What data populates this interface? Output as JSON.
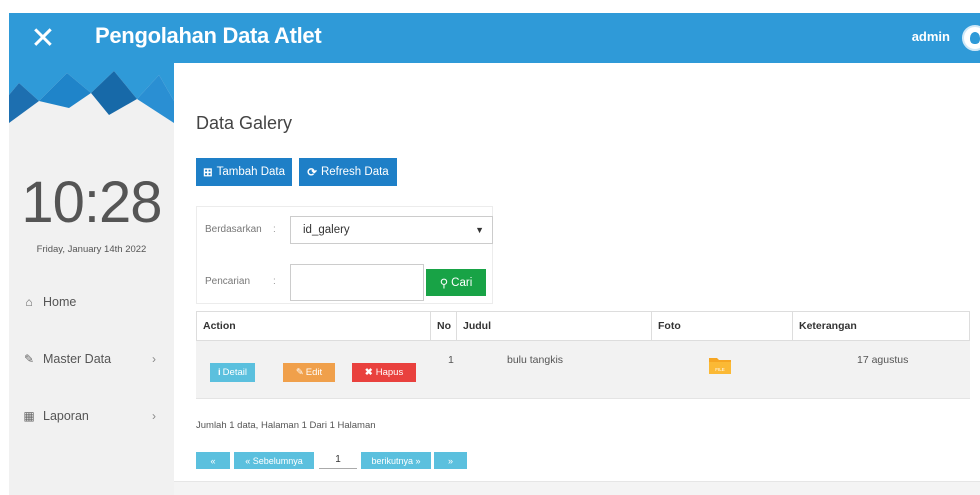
{
  "header": {
    "close_icon": "close-icon",
    "title": "Pengolahan Data Atlet",
    "user": "admin",
    "accent_color": "#2f9ad8"
  },
  "sidebar": {
    "time": "10:28",
    "date": "Friday, January 14th 2022",
    "items": [
      {
        "icon": "home-icon",
        "glyph": "⌂",
        "label": "Home",
        "has_arrow": false
      },
      {
        "icon": "edit-icon",
        "glyph": "✎",
        "label": "Master Data",
        "has_arrow": true
      },
      {
        "icon": "calendar-icon",
        "glyph": "▦",
        "label": "Laporan",
        "has_arrow": true
      }
    ],
    "arrow_glyph": "›"
  },
  "main": {
    "title": "Data Galery",
    "add_button": "Tambah Data",
    "refresh_button": "Refresh Data",
    "filter": {
      "by_label": "Berdasarkan",
      "by_value": "id_galery",
      "search_label": "Pencarian",
      "search_value": "",
      "search_button": "Cari",
      "colon": ":"
    },
    "table": {
      "headers": [
        "Action",
        "No",
        "Judul",
        "Foto",
        "Keterangan"
      ],
      "rows": [
        {
          "detail": "Detail",
          "edit": "Edit",
          "hapus": "Hapus",
          "no": "1",
          "judul": "bulu tangkis",
          "foto_icon": "file-folder-icon",
          "foto_label": "FILE",
          "keterangan": "17 agustus"
        }
      ]
    },
    "paging": {
      "info": "Jumlah 1 data, Halaman 1 Dari 1 Halaman",
      "first": "«",
      "prev": "« Sebelumnya",
      "page": "1",
      "next": "berikutnya »",
      "last": "»"
    }
  }
}
